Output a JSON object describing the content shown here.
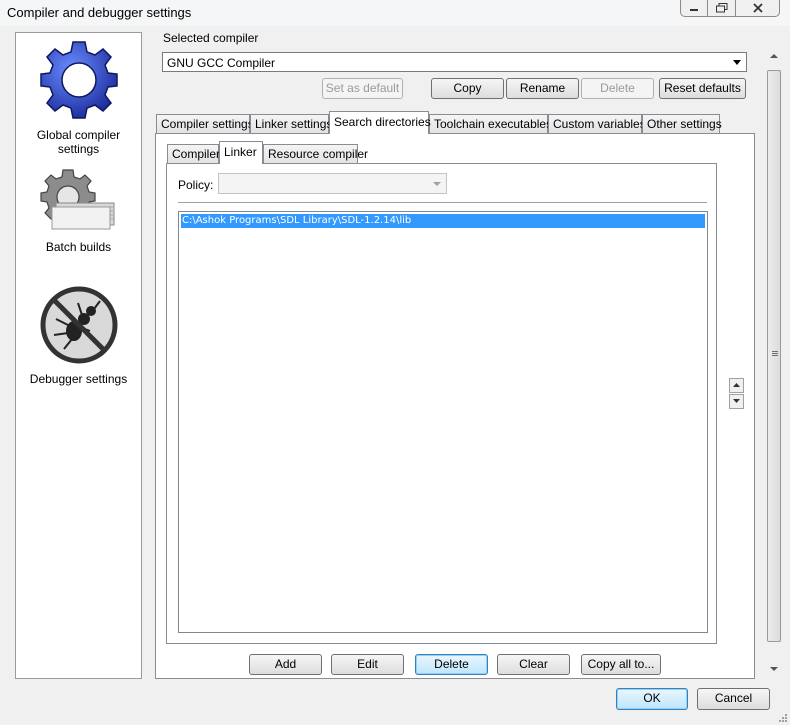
{
  "window": {
    "title": "Compiler and debugger settings"
  },
  "left_panel": {
    "items": [
      {
        "label": "Global compiler settings",
        "icon": "gear-icon"
      },
      {
        "label": "Batch builds",
        "icon": "batch-gear-icon"
      },
      {
        "label": "Debugger settings",
        "icon": "no-bug-icon"
      }
    ]
  },
  "compiler": {
    "group_label": "Selected compiler",
    "selected": "GNU GCC Compiler",
    "buttons": {
      "set_default": "Set as default",
      "copy": "Copy",
      "rename": "Rename",
      "delete": "Delete",
      "reset": "Reset defaults"
    }
  },
  "tabs": [
    "Compiler settings",
    "Linker settings",
    "Search directories",
    "Toolchain executables",
    "Custom variables",
    "Other settings"
  ],
  "subtabs": [
    "Compiler",
    "Linker",
    "Resource compiler"
  ],
  "policy": {
    "label": "Policy:",
    "value": ""
  },
  "directories": [
    "C:\\Ashok Programs\\SDL Library\\SDL-1.2.14\\lib"
  ],
  "list_buttons": {
    "add": "Add",
    "edit": "Edit",
    "delete": "Delete",
    "clear": "Clear",
    "copy_all": "Copy all to..."
  },
  "dialog_buttons": {
    "ok": "OK",
    "cancel": "Cancel"
  },
  "colors": {
    "selection": "#3399ff",
    "gear_blue": "#2d3fb0"
  }
}
